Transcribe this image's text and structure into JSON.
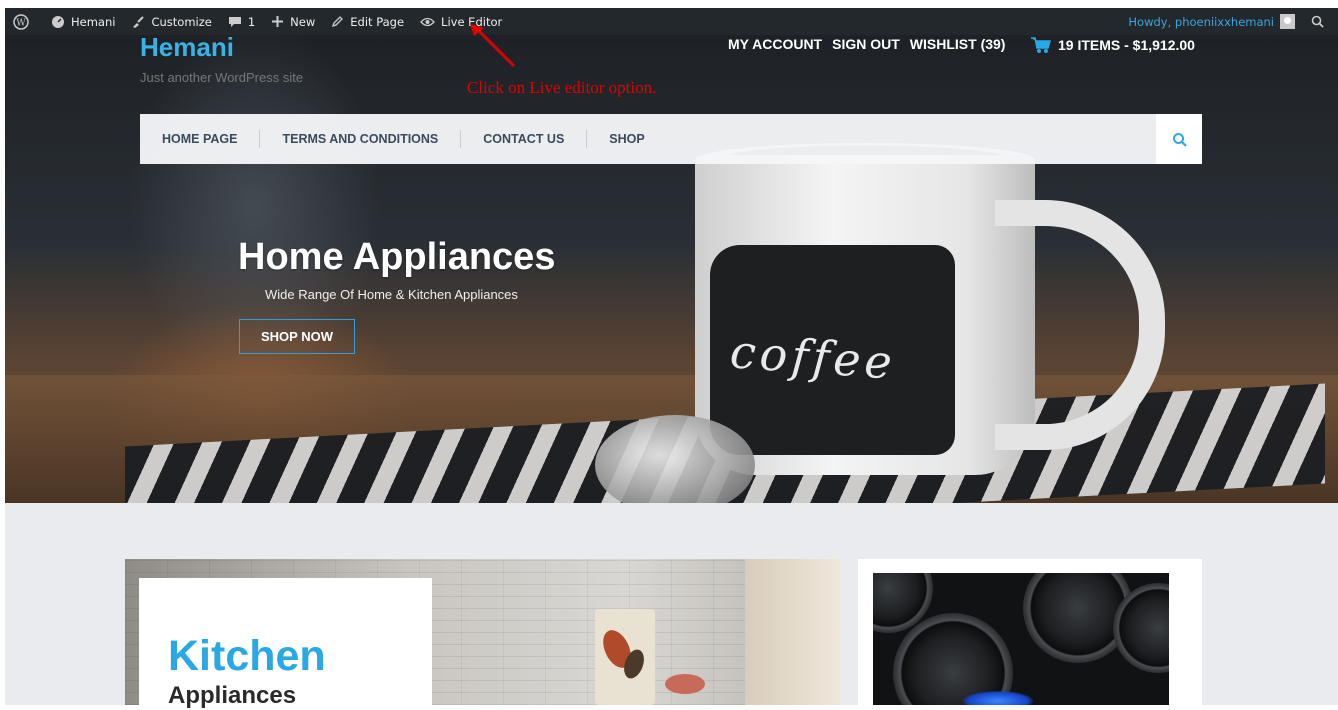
{
  "adminbar": {
    "site": "Hemani",
    "customize": "Customize",
    "comments_count": "1",
    "new": "New",
    "edit_page": "Edit Page",
    "live_editor": "Live Editor",
    "howdy": "Howdy, phoeniixxhemani"
  },
  "site": {
    "title": "Hemani",
    "tagline": "Just another WordPress site"
  },
  "annotation": "Click on Live editor option.",
  "account_links": [
    "MY ACCOUNT",
    "SIGN OUT",
    "WISHLIST (39)"
  ],
  "cart": "19 ITEMS - $1,912.00",
  "nav": [
    "HOME PAGE",
    "TERMS AND CONDITIONS",
    "CONTACT US",
    "SHOP"
  ],
  "hero": {
    "title": "Home Appliances",
    "subtitle": "Wide Range Of Home & Kitchen Appliances",
    "button": "SHOP NOW",
    "mug_text": "coffee"
  },
  "promo": {
    "title": "Kitchen",
    "subtitle": "Appliances"
  },
  "colors": {
    "accent": "#39b3e6",
    "adminbar": "#23282d",
    "annotation": "#e00000"
  }
}
